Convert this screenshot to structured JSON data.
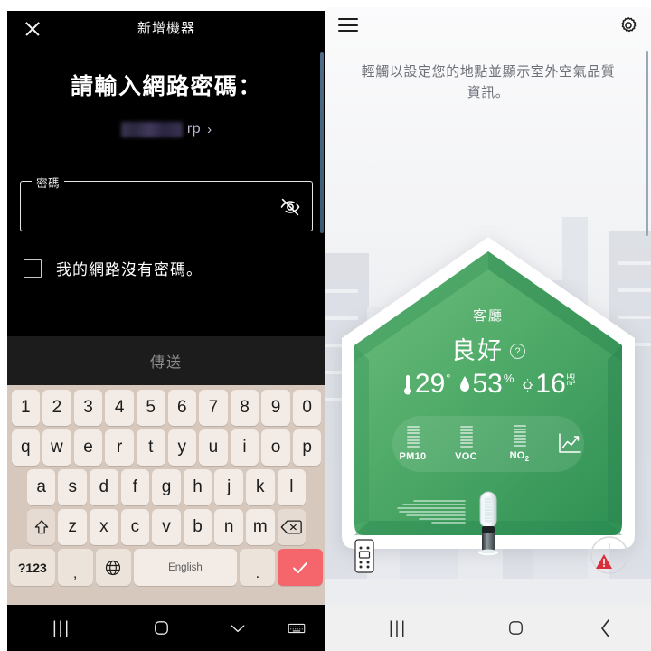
{
  "left_screen": {
    "header": {
      "title": "新增機器",
      "close_icon": "close-icon"
    },
    "heading": "請輸入網路密碼：",
    "network": {
      "ssid_visible_text": "rp",
      "ssid_redacted": true,
      "chevron": "›"
    },
    "password_field": {
      "label": "密碼",
      "value": "",
      "placeholder": "",
      "toggle_icon": "eye-off-icon"
    },
    "no_password_checkbox": {
      "label": "我的網路沒有密碼。",
      "checked": false
    },
    "send_button": {
      "label": "傳送",
      "enabled": false
    },
    "keyboard": {
      "row1": [
        "1",
        "2",
        "3",
        "4",
        "5",
        "6",
        "7",
        "8",
        "9",
        "0"
      ],
      "row2": [
        "q",
        "w",
        "e",
        "r",
        "t",
        "y",
        "u",
        "i",
        "o",
        "p"
      ],
      "row3": [
        "a",
        "s",
        "d",
        "f",
        "g",
        "h",
        "j",
        "k",
        "l"
      ],
      "row4": [
        "z",
        "x",
        "c",
        "v",
        "b",
        "n",
        "m"
      ],
      "shift_key": "shift-icon",
      "backspace_key": "backspace-icon",
      "symbols_key": "?123",
      "comma_key": ",",
      "globe_key": "globe-icon",
      "space_key": "English",
      "period_key": ".",
      "enter_key": "check-icon",
      "enter_color": "#f4656c"
    },
    "navbar": {
      "recent": "|||",
      "home": "home-icon",
      "collapse": "chevron-down-icon",
      "keyboard": "keyboard-icon"
    }
  },
  "right_screen": {
    "header": {
      "menu_icon": "hamburger-menu-icon",
      "settings_icon": "gear-icon"
    },
    "hint_text": "輕觸以設定您的地點並顯示室外空氣品質資訊。",
    "house_card": {
      "room_name": "客廳",
      "air_quality_status": "良好",
      "help_icon": "question-mark-icon",
      "status_color": "#4caf66",
      "metrics": [
        {
          "icon": "thermometer-icon",
          "value": "29",
          "unit": "°"
        },
        {
          "icon": "humidity-drop-icon",
          "value": "53",
          "unit": "%"
        },
        {
          "icon": "particle-icon",
          "value": "16",
          "unit_top": "µg",
          "unit_bottom": "m³"
        }
      ],
      "pollutants": [
        {
          "label": "PM10"
        },
        {
          "label": "VOC"
        },
        {
          "label": "NO",
          "sub": "2"
        }
      ],
      "chart_icon": "line-chart-icon",
      "device_icon": "air-purifier-icon"
    },
    "remote_icon": "remote-control-icon",
    "timer_icon": "timer-clock-icon",
    "warning_icon": "warning-triangle-icon",
    "warning_color": "#d92d3a",
    "navbar": {
      "recent": "|||",
      "home": "home-icon",
      "back": "back-chevron-icon"
    }
  }
}
